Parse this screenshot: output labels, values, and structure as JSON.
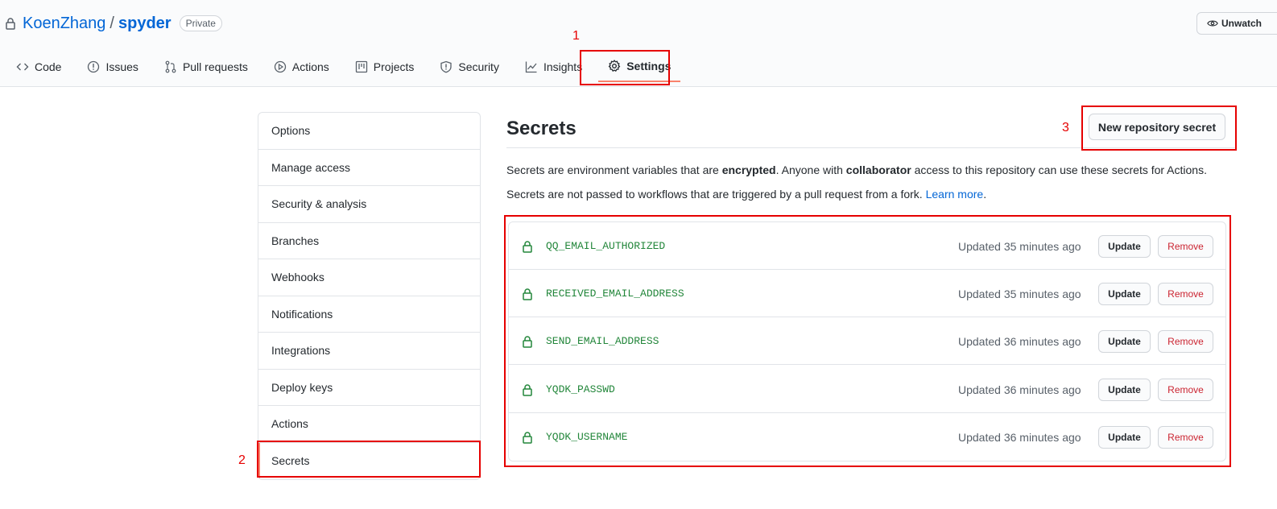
{
  "repo": {
    "owner": "KoenZhang",
    "separator": "/",
    "name": "spyder",
    "visibility": "Private",
    "unwatch_label": "Unwatch"
  },
  "tabs": [
    {
      "label": "Code",
      "icon": "code-icon"
    },
    {
      "label": "Issues",
      "icon": "issue-icon"
    },
    {
      "label": "Pull requests",
      "icon": "pull-request-icon"
    },
    {
      "label": "Actions",
      "icon": "play-icon"
    },
    {
      "label": "Projects",
      "icon": "project-icon"
    },
    {
      "label": "Security",
      "icon": "shield-icon"
    },
    {
      "label": "Insights",
      "icon": "graph-icon"
    },
    {
      "label": "Settings",
      "icon": "gear-icon",
      "selected": true
    }
  ],
  "sidebar": {
    "items": [
      {
        "label": "Options"
      },
      {
        "label": "Manage access"
      },
      {
        "label": "Security & analysis"
      },
      {
        "label": "Branches"
      },
      {
        "label": "Webhooks"
      },
      {
        "label": "Notifications"
      },
      {
        "label": "Integrations"
      },
      {
        "label": "Deploy keys"
      },
      {
        "label": "Actions"
      },
      {
        "label": "Secrets",
        "selected": true
      }
    ]
  },
  "main": {
    "title": "Secrets",
    "new_button_label": "New repository secret",
    "desc1": {
      "part1": "Secrets are environment variables that are ",
      "bold1": "encrypted",
      "part2": ". Anyone with ",
      "bold2": "collaborator",
      "part3": " access to this repository can use these secrets for Actions."
    },
    "desc2": {
      "text": "Secrets are not passed to workflows that are triggered by a pull request from a fork. ",
      "link": "Learn more",
      "end": "."
    },
    "secrets": [
      {
        "name": "QQ_EMAIL_AUTHORIZED",
        "updated": "Updated 35 minutes ago",
        "update_label": "Update",
        "remove_label": "Remove"
      },
      {
        "name": "RECEIVED_EMAIL_ADDRESS",
        "updated": "Updated 35 minutes ago",
        "update_label": "Update",
        "remove_label": "Remove"
      },
      {
        "name": "SEND_EMAIL_ADDRESS",
        "updated": "Updated 36 minutes ago",
        "update_label": "Update",
        "remove_label": "Remove"
      },
      {
        "name": "YQDK_PASSWD",
        "updated": "Updated 36 minutes ago",
        "update_label": "Update",
        "remove_label": "Remove"
      },
      {
        "name": "YQDK_USERNAME",
        "updated": "Updated 36 minutes ago",
        "update_label": "Update",
        "remove_label": "Remove"
      }
    ]
  },
  "annotations": {
    "step1": "1",
    "step2": "2",
    "step3": "3",
    "color": "#e60000"
  },
  "colors": {
    "link": "#0366d6",
    "secret_name": "#22863a",
    "remove": "#cb2431",
    "tab_underline": "#f9826c"
  }
}
